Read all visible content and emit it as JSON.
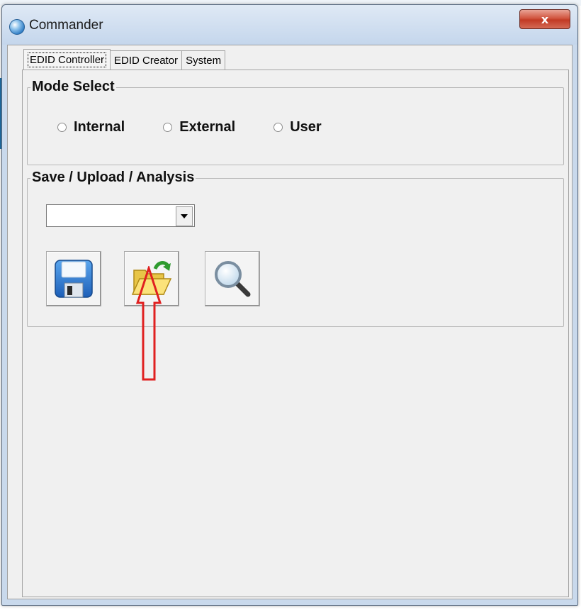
{
  "window": {
    "title": "Commander",
    "close_glyph": "x"
  },
  "tabs": [
    {
      "label": "EDID Controller",
      "active": true
    },
    {
      "label": "EDID Creator",
      "active": false
    },
    {
      "label": "System",
      "active": false
    }
  ],
  "mode_select": {
    "legend": "Mode Select",
    "options": [
      "Internal",
      "External",
      "User"
    ],
    "selected": null
  },
  "save_upload": {
    "legend": "Save / Upload / Analysis",
    "dropdown_value": "",
    "buttons": [
      {
        "name": "save",
        "icon": "floppy-disk-icon"
      },
      {
        "name": "upload",
        "icon": "open-folder-icon"
      },
      {
        "name": "analysis",
        "icon": "magnifier-icon"
      }
    ]
  },
  "annotation": {
    "icon": "red-outline-up-arrow",
    "color": "#e02020"
  }
}
